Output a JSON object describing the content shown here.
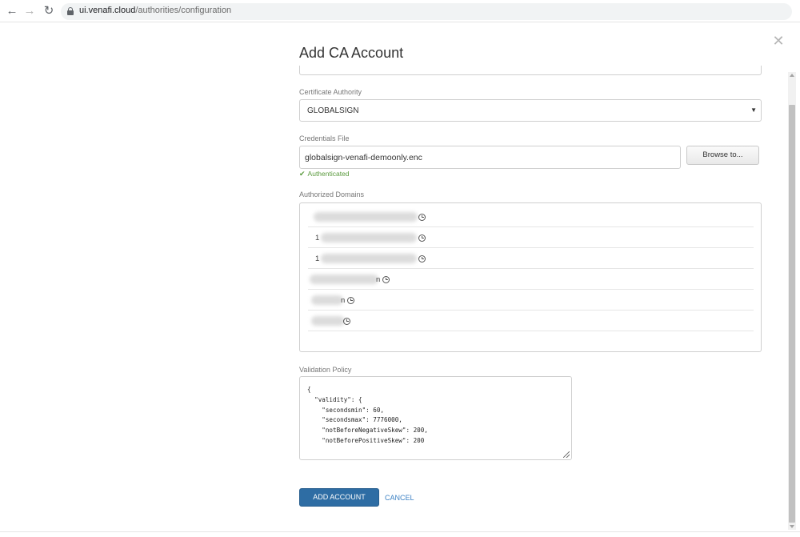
{
  "browser": {
    "url_host": "ui.venafi.cloud",
    "url_path": "/authorities/configuration"
  },
  "modal": {
    "title": "Add CA Account"
  },
  "certificate_authority": {
    "label": "Certificate Authority",
    "value": "GLOBALSIGN"
  },
  "credentials": {
    "label": "Credentials File",
    "value": "globalsign-venafi-demoonly.enc",
    "browse_label": "Browse to...",
    "status": "Authenticated"
  },
  "authorized_domains": {
    "label": "Authorized Domains",
    "rows": [
      {
        "prefix": "",
        "suffix": "",
        "icon": "clock-icon"
      },
      {
        "prefix": "1",
        "suffix": "",
        "icon": "clock-icon"
      },
      {
        "prefix": "1",
        "suffix": "",
        "icon": "clock-icon"
      },
      {
        "prefix": "",
        "suffix": "n",
        "icon": "clock-icon"
      },
      {
        "prefix": "",
        "suffix": "n",
        "icon": "clock-icon"
      },
      {
        "prefix": "",
        "suffix": "",
        "icon": "clock-icon"
      }
    ]
  },
  "validation_policy": {
    "label": "Validation Policy",
    "value": "{\n  \"validity\": {\n    \"secondsmin\": 60,\n    \"secondsmax\": 7776000,\n    \"notBeforeNegativeSkew\": 200,\n    \"notBeforePositiveSkew\": 200"
  },
  "actions": {
    "add_label": "ADD ACCOUNT",
    "cancel_label": "CANCEL"
  },
  "colors": {
    "primary_button": "#2e6da4",
    "link": "#3d82c4",
    "success": "#5a9a3d"
  }
}
